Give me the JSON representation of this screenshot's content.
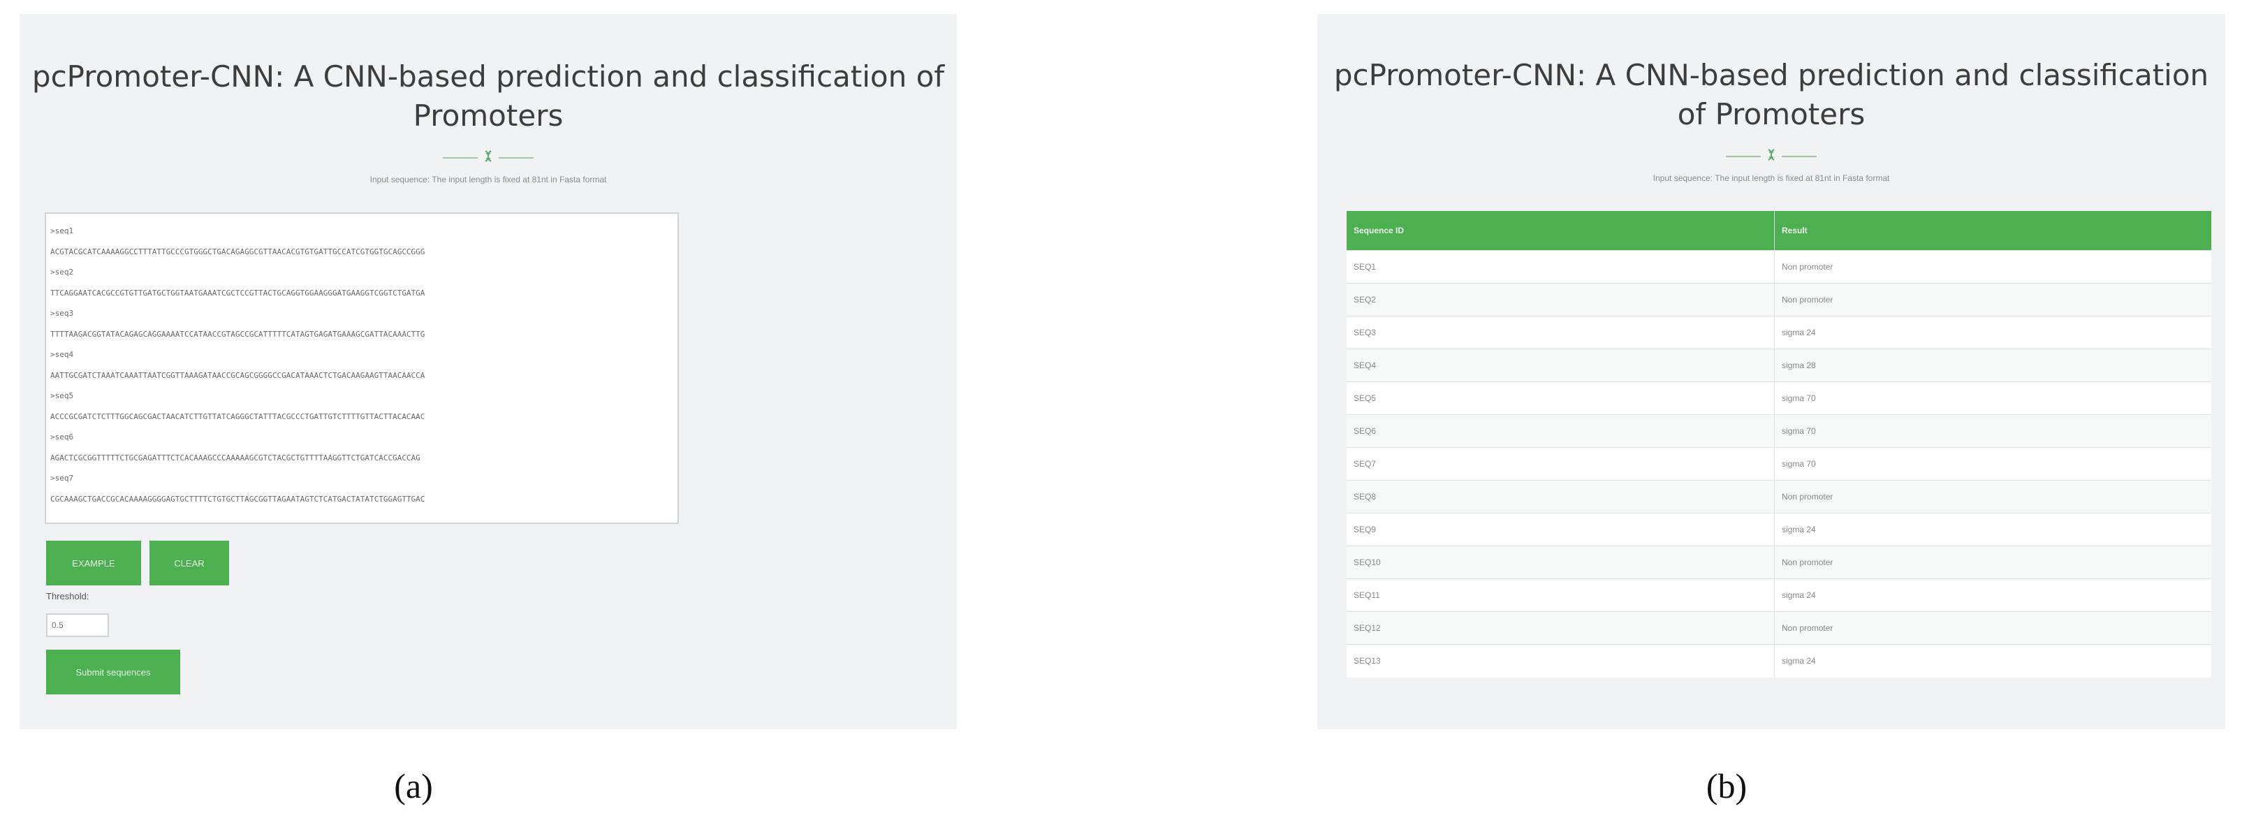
{
  "app_title": "pcPromoter-CNN: A CNN-based prediction and classification of Promoters",
  "subtitle": "Input sequence: The input length is fixed at 81nt in Fasta format",
  "panel_a": {
    "sequence_lines": [
      ">seq1",
      "ACGTACGCATCAAAAGGCCTTTATTGCCCGTGGGCTGACAGAGGCGTTAACACGTGTGATTGCCATCGTGGTGCAGCCGGG",
      ">seq2",
      "TTCAGGAATCACGCCGTGTTGATGCTGGTAATGAAATCGCTCCGTTACTGCAGGTGGAAGGGATGAAGGTCGGTCTGATGA",
      ">seq3",
      "TTTTAAGACGGTATACAGAGCAGGAAAATCCATAACCGTAGCCGCATTTTTCATAGTGAGATGAAAGCGATTACAAACTTG",
      ">seq4",
      "AATTGCGATCTAAATCAAATTAATCGGTTAAAGATAACCGCAGCGGGGCCGACATAAACTCTGACAAGAAGTTAACAACCA",
      ">seq5",
      "ACCCGCGATCTCTTTGGCAGCGACTAACATCTTGTTATCAGGGCTATTTACGCCCTGATTGTCTTTTGTTACTTACACAAC",
      ">seq6",
      "AGACTCGCGGTTTTTCTGCGAGATTTCTCACAAAGCCCAAAAAGCGTCTACGCTGTTTTAAGGTTCTGATCACCGACCAG",
      ">seq7",
      "CGCAAAGCTGACCGCACAAAAGGGGAGTGCTTTTCTGTGCTTAGCGGTTAGAATAGTCTCATGACTATATCTGGAGTTGAC"
    ],
    "example_label": "EXAMPLE",
    "clear_label": "CLEAR",
    "threshold_label": "Threshold:",
    "threshold_value": "0.5",
    "submit_label": "Submit sequences"
  },
  "panel_b": {
    "columns": [
      "Sequence ID",
      "Result"
    ],
    "rows": [
      [
        "SEQ1",
        "Non promoter"
      ],
      [
        "SEQ2",
        "Non promoter"
      ],
      [
        "SEQ3",
        "sigma 24"
      ],
      [
        "SEQ4",
        "sigma 28"
      ],
      [
        "SEQ5",
        "sigma 70"
      ],
      [
        "SEQ6",
        "sigma 70"
      ],
      [
        "SEQ7",
        "sigma 70"
      ],
      [
        "SEQ8",
        "Non promoter"
      ],
      [
        "SEQ9",
        "sigma 24"
      ],
      [
        "SEQ10",
        "Non promoter"
      ],
      [
        "SEQ11",
        "sigma 24"
      ],
      [
        "SEQ12",
        "Non promoter"
      ],
      [
        "SEQ13",
        "sigma 24"
      ]
    ]
  },
  "captions": {
    "a": "(a)",
    "b": "(b)"
  },
  "colors": {
    "accent_green": "#4caf50",
    "panel_bg": "#f1f2f3",
    "title_text": "#3d3d3d"
  },
  "icons": {
    "divider": "dna-helix-icon"
  }
}
